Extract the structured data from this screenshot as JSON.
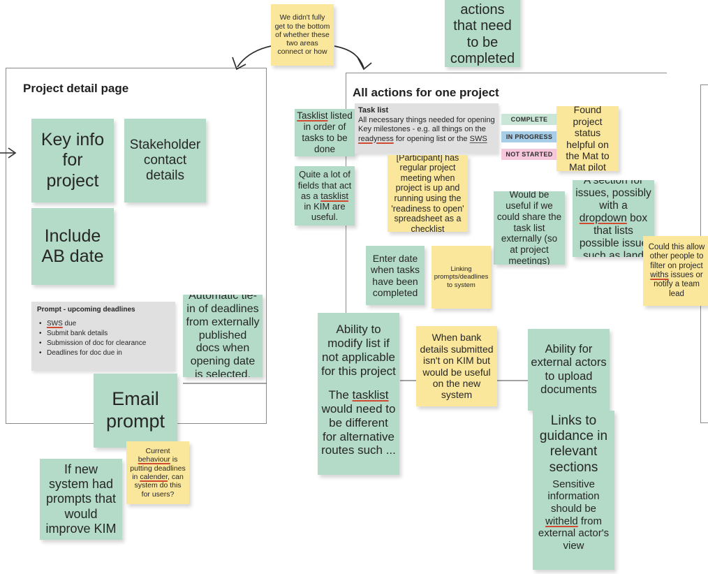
{
  "board": {
    "frames": [
      {
        "name": "project-detail-frame",
        "title": "Project detail page"
      },
      {
        "name": "all-actions-frame",
        "title": "All actions for one project"
      },
      {
        "name": "right-frame",
        "title": ""
      }
    ]
  },
  "notes": {
    "didnt_fully_get": "We didn't fully get to the bottom of whether these two areas connect or how",
    "list_all_actions": "List all the actions that need to be completed",
    "key_info": "Key info for project",
    "stakeholder_contact": "Stakeholder contact details",
    "include_ab_date": "Include AB date",
    "email_prompt": "Email prompt",
    "automatic_tie_in": "Automatic tie-in of deadlines from externally published docs when opening date is selected.",
    "current_behaviour": "Current behaviour is putting deadlines in calender, can system do this for users?",
    "if_new_system": "If new system had prompts that would improve KIM",
    "tasklist_listed": "Tasklist listed in order of tasks to be done",
    "quite_a_lot_fields": "Quite a lot of fields that act as a tasklist in KIM are useful.",
    "participant_meeting": "[Participant] has regular project meeting when project is up and running using the 'readiness to open' spreadsheet as a checklist",
    "found_project_status": "Found project status helpful on the Mat to Mat pilot",
    "would_be_useful_share": "Would be useful if we could share the task list externally (so at project meetings)",
    "section_for_issues": "A section for issues, possibly with a dropdown box that lists possible issue such as land",
    "could_this_allow": "Could this allow other people to filter on project withs issues or notify a team lead",
    "enter_date": "Enter date when tasks have been completed",
    "linking_prompts": "Linking prompts/deadlines to system",
    "ability_modify_a": "Ability to modify list if not applicable for this project",
    "ability_modify_b": "The tasklist would need to be different for alternative routes such ...",
    "when_bank_details": "When bank details submitted isn't on KIM but would be useful on the new system",
    "ability_external_upload": "Ability for external actors to upload documents",
    "links_to_guidance": "Links to guidance in relevant sections",
    "sensitive_information": "Sensitive information should be witheld from external actor's view"
  },
  "prompt_card": {
    "title": "Prompt - upcoming deadlines",
    "items": [
      "SWS due",
      "Submit bank details",
      "Submission of doc for clearance",
      "Deadlines for doc due in"
    ]
  },
  "task_list_card": {
    "title": "Task list",
    "line1": "All necessary things needed for opening",
    "line2": "Key milestones - e.g. all things on the readyness for opening list or the SWS"
  },
  "status_badges": [
    {
      "label": "COMPLETE",
      "color": "#c9e6d6"
    },
    {
      "label": "IN PROGRESS",
      "color": "#a8cde8"
    },
    {
      "label": "NOT STARTED",
      "color": "#f6c6da"
    }
  ],
  "palette": {
    "green_note": "#b4dbc8",
    "yellow_note": "#fbe79c",
    "grey_card": "#e0e0e0",
    "frame_border": "#8a8a8a",
    "spellcheck_underline": "#d04a32",
    "text": "#262626"
  }
}
